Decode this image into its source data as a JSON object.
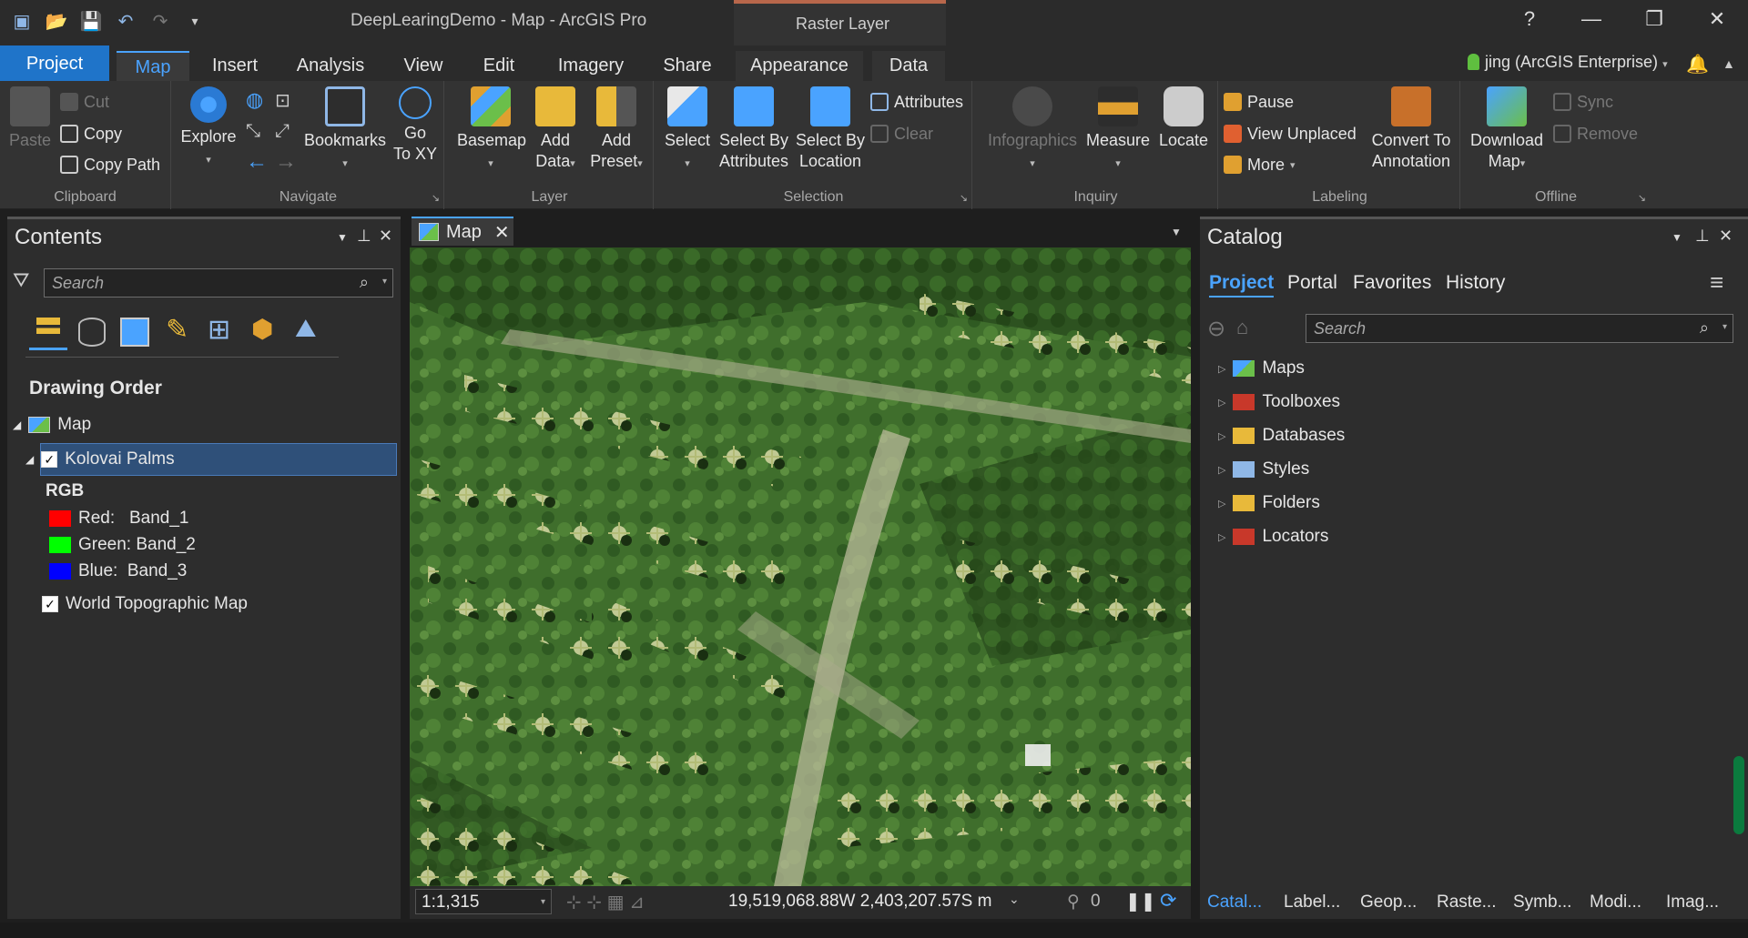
{
  "window": {
    "title": "DeepLearingDemo - Map - ArcGIS Pro",
    "context_band": "Raster Layer",
    "help": "?",
    "minimize": "—",
    "restore": "❐",
    "close": "✕"
  },
  "tabs": [
    "Project",
    "Map",
    "Insert",
    "Analysis",
    "View",
    "Edit",
    "Imagery",
    "Share",
    "Appearance",
    "Data"
  ],
  "user": "jing (ArcGIS Enterprise)",
  "ribbon": {
    "clipboard": {
      "label": "Clipboard",
      "paste": "Paste",
      "cut": "Cut",
      "copy": "Copy",
      "copy_path": "Copy Path"
    },
    "navigate": {
      "label": "Navigate",
      "explore": "Explore",
      "bookmarks": "Bookmarks",
      "go_to_xy_1": "Go",
      "go_to_xy_2": "To XY"
    },
    "layer": {
      "label": "Layer",
      "basemap": "Basemap",
      "add_data_1": "Add",
      "add_data_2": "Data",
      "add_preset_1": "Add",
      "add_preset_2": "Preset"
    },
    "selection": {
      "label": "Selection",
      "select": "Select",
      "select_by_attr_1": "Select By",
      "select_by_attr_2": "Attributes",
      "select_by_loc_1": "Select By",
      "select_by_loc_2": "Location",
      "attributes": "Attributes",
      "clear": "Clear"
    },
    "inquiry": {
      "label": "Inquiry",
      "infographics": "Infographics",
      "measure": "Measure",
      "locate": "Locate"
    },
    "labeling": {
      "label": "Labeling",
      "pause": "Pause",
      "view_unplaced": "View Unplaced",
      "more": "More",
      "convert_1": "Convert To",
      "convert_2": "Annotation"
    },
    "offline": {
      "label": "Offline",
      "download_1": "Download",
      "download_2": "Map",
      "sync": "Sync",
      "remove": "Remove"
    }
  },
  "contents": {
    "title": "Contents",
    "search_placeholder": "Search",
    "section": "Drawing Order",
    "map": "Map",
    "layer1": "Kolovai Palms",
    "rgb": "RGB",
    "red": "Red:   Band_1",
    "green": "Green: Band_2",
    "blue": "Blue:  Band_3",
    "layer2": "World Topographic Map",
    "colors": {
      "red": "#ff0000",
      "green": "#00ff00",
      "blue": "#0000ff"
    }
  },
  "map": {
    "tab": "Map",
    "scale": "1:1,315",
    "coords": "19,519,068.88W 2,403,207.57S m",
    "selected_count": "0"
  },
  "catalog": {
    "title": "Catalog",
    "tabs": [
      "Project",
      "Portal",
      "Favorites",
      "History"
    ],
    "search_placeholder": "Search",
    "items": [
      "Maps",
      "Toolboxes",
      "Databases",
      "Styles",
      "Folders",
      "Locators"
    ],
    "bottom_tabs": [
      "Catal...",
      "Label...",
      "Geop...",
      "Raste...",
      "Symb...",
      "Modi...",
      "Imag..."
    ]
  }
}
